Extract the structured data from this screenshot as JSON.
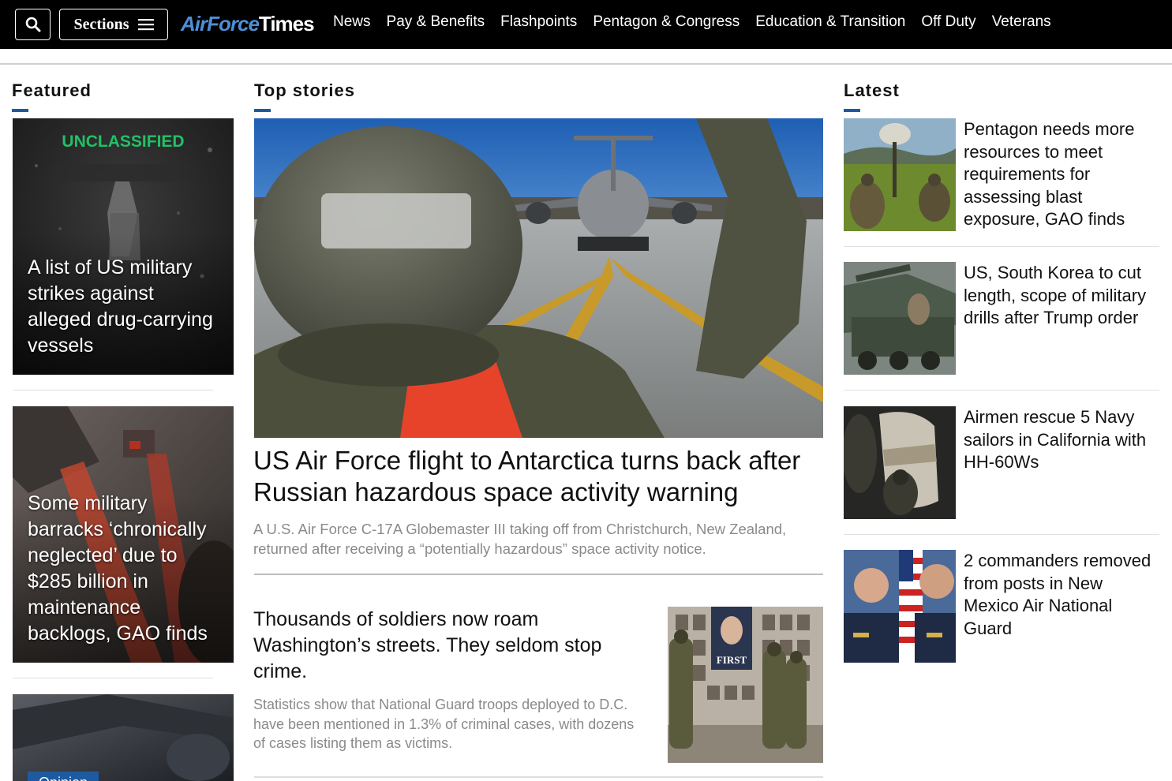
{
  "header": {
    "search_icon": "search-icon",
    "sections_label": "Sections",
    "menu_icon": "hamburger-icon",
    "logo_part1": "AirForce",
    "logo_part2": "Times",
    "nav": [
      "News",
      "Pay & Benefits",
      "Flashpoints",
      "Pentagon & Congress",
      "Education & Transition",
      "Off Duty",
      "Veterans"
    ]
  },
  "featured": {
    "heading": "Featured",
    "items": [
      {
        "image_text": "UNCLASSIFIED",
        "title": "A list of US military strikes against alleged drug-carrying vessels"
      },
      {
        "title": "Some military barracks ‘chronically neglected’ due to $285 billion in maintenance backlogs, GAO finds"
      },
      {
        "tag": "Opinion",
        "title": ""
      }
    ]
  },
  "top_stories": {
    "heading": "Top stories",
    "lead": {
      "title": "US Air Force flight to Antarctica turns back after Russian hazardous space activity warning",
      "summary": "A U.S. Air Force C-17A Globemaster III taking off from Christchurch, New Zealand, returned after receiving a “potentially hazardous” space activity notice."
    },
    "second": {
      "title": "Thousands of soldiers now roam Washington’s streets. They seldom stop crime.",
      "summary": "Statistics show that National Guard troops deployed to D.C. have been mentioned in 1.3% of criminal cases, with dozens of cases listing them as victims.",
      "image_banner_text": "FIRST"
    }
  },
  "latest": {
    "heading": "Latest",
    "items": [
      {
        "title": "Pentagon needs more resources to meet requirements for assessing blast exposure, GAO finds"
      },
      {
        "title": "US, South Korea to cut length, scope of military drills after Trump order"
      },
      {
        "title": "Airmen rescue 5 Navy sailors in California with HH-60Ws"
      },
      {
        "title": "2 commanders removed from posts in New Mexico Air National Guard"
      }
    ]
  },
  "colors": {
    "nav_bg": "#000000",
    "accent": "#1e5aa0",
    "logo_blue": "#4d8fd6",
    "summary_gray": "#8a8a8a"
  }
}
